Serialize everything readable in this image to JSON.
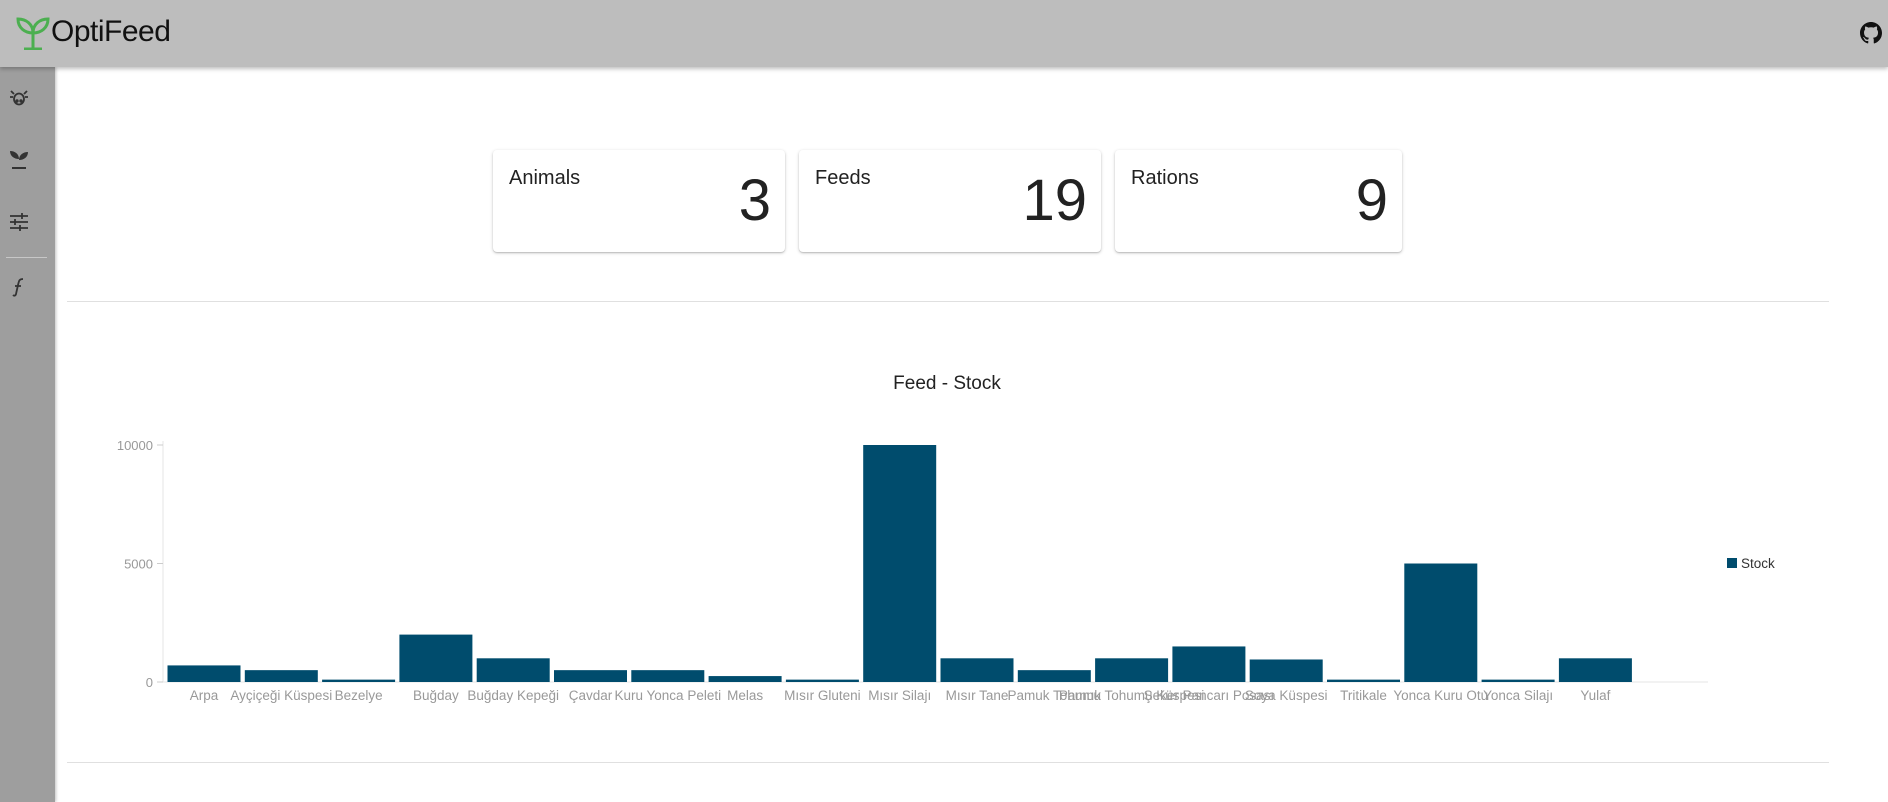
{
  "app": {
    "name": "OptiFeed"
  },
  "sidebar": {
    "items": [
      {
        "icon": "cow-icon"
      },
      {
        "icon": "sprout-icon"
      },
      {
        "icon": "sliders-icon"
      },
      {
        "icon": "function-icon"
      }
    ]
  },
  "stats": [
    {
      "label": "Animals",
      "value": "3"
    },
    {
      "label": "Feeds",
      "value": "19"
    },
    {
      "label": "Rations",
      "value": "9"
    }
  ],
  "colors": {
    "bar": "#004c6d",
    "appbar": "#bdbdbd",
    "sidebar": "#9e9e9e",
    "accent": "#4caf50"
  },
  "chart_data": {
    "type": "bar",
    "title": "Feed - Stock",
    "categories": [
      "Arpa",
      "Ayçiçeği Küspesi",
      "Bezelye",
      "Buğday",
      "Buğday Kepeği",
      "Çavdar",
      "Kuru Yonca Peleti",
      "Melas",
      "Mısır Gluteni",
      "Mısır Silajı",
      "Mısır Tane",
      "Pamuk Tohumu",
      "Pamuk Tohumu Küspesi",
      "Şeker Pancarı Posası",
      "Soya Küspesi",
      "Tritikale",
      "Yonca Kuru Otu",
      "Yonca Silajı",
      "Yulaf"
    ],
    "series": [
      {
        "name": "Stock",
        "values": [
          700,
          500,
          100,
          2000,
          1000,
          500,
          500,
          250,
          100,
          10000,
          1000,
          500,
          1000,
          1500,
          950,
          100,
          5000,
          100,
          1000
        ]
      }
    ],
    "yticks": [
      "0",
      "5000",
      "10000"
    ],
    "ylim": [
      0,
      10000
    ],
    "legend": "right",
    "grid": false
  }
}
